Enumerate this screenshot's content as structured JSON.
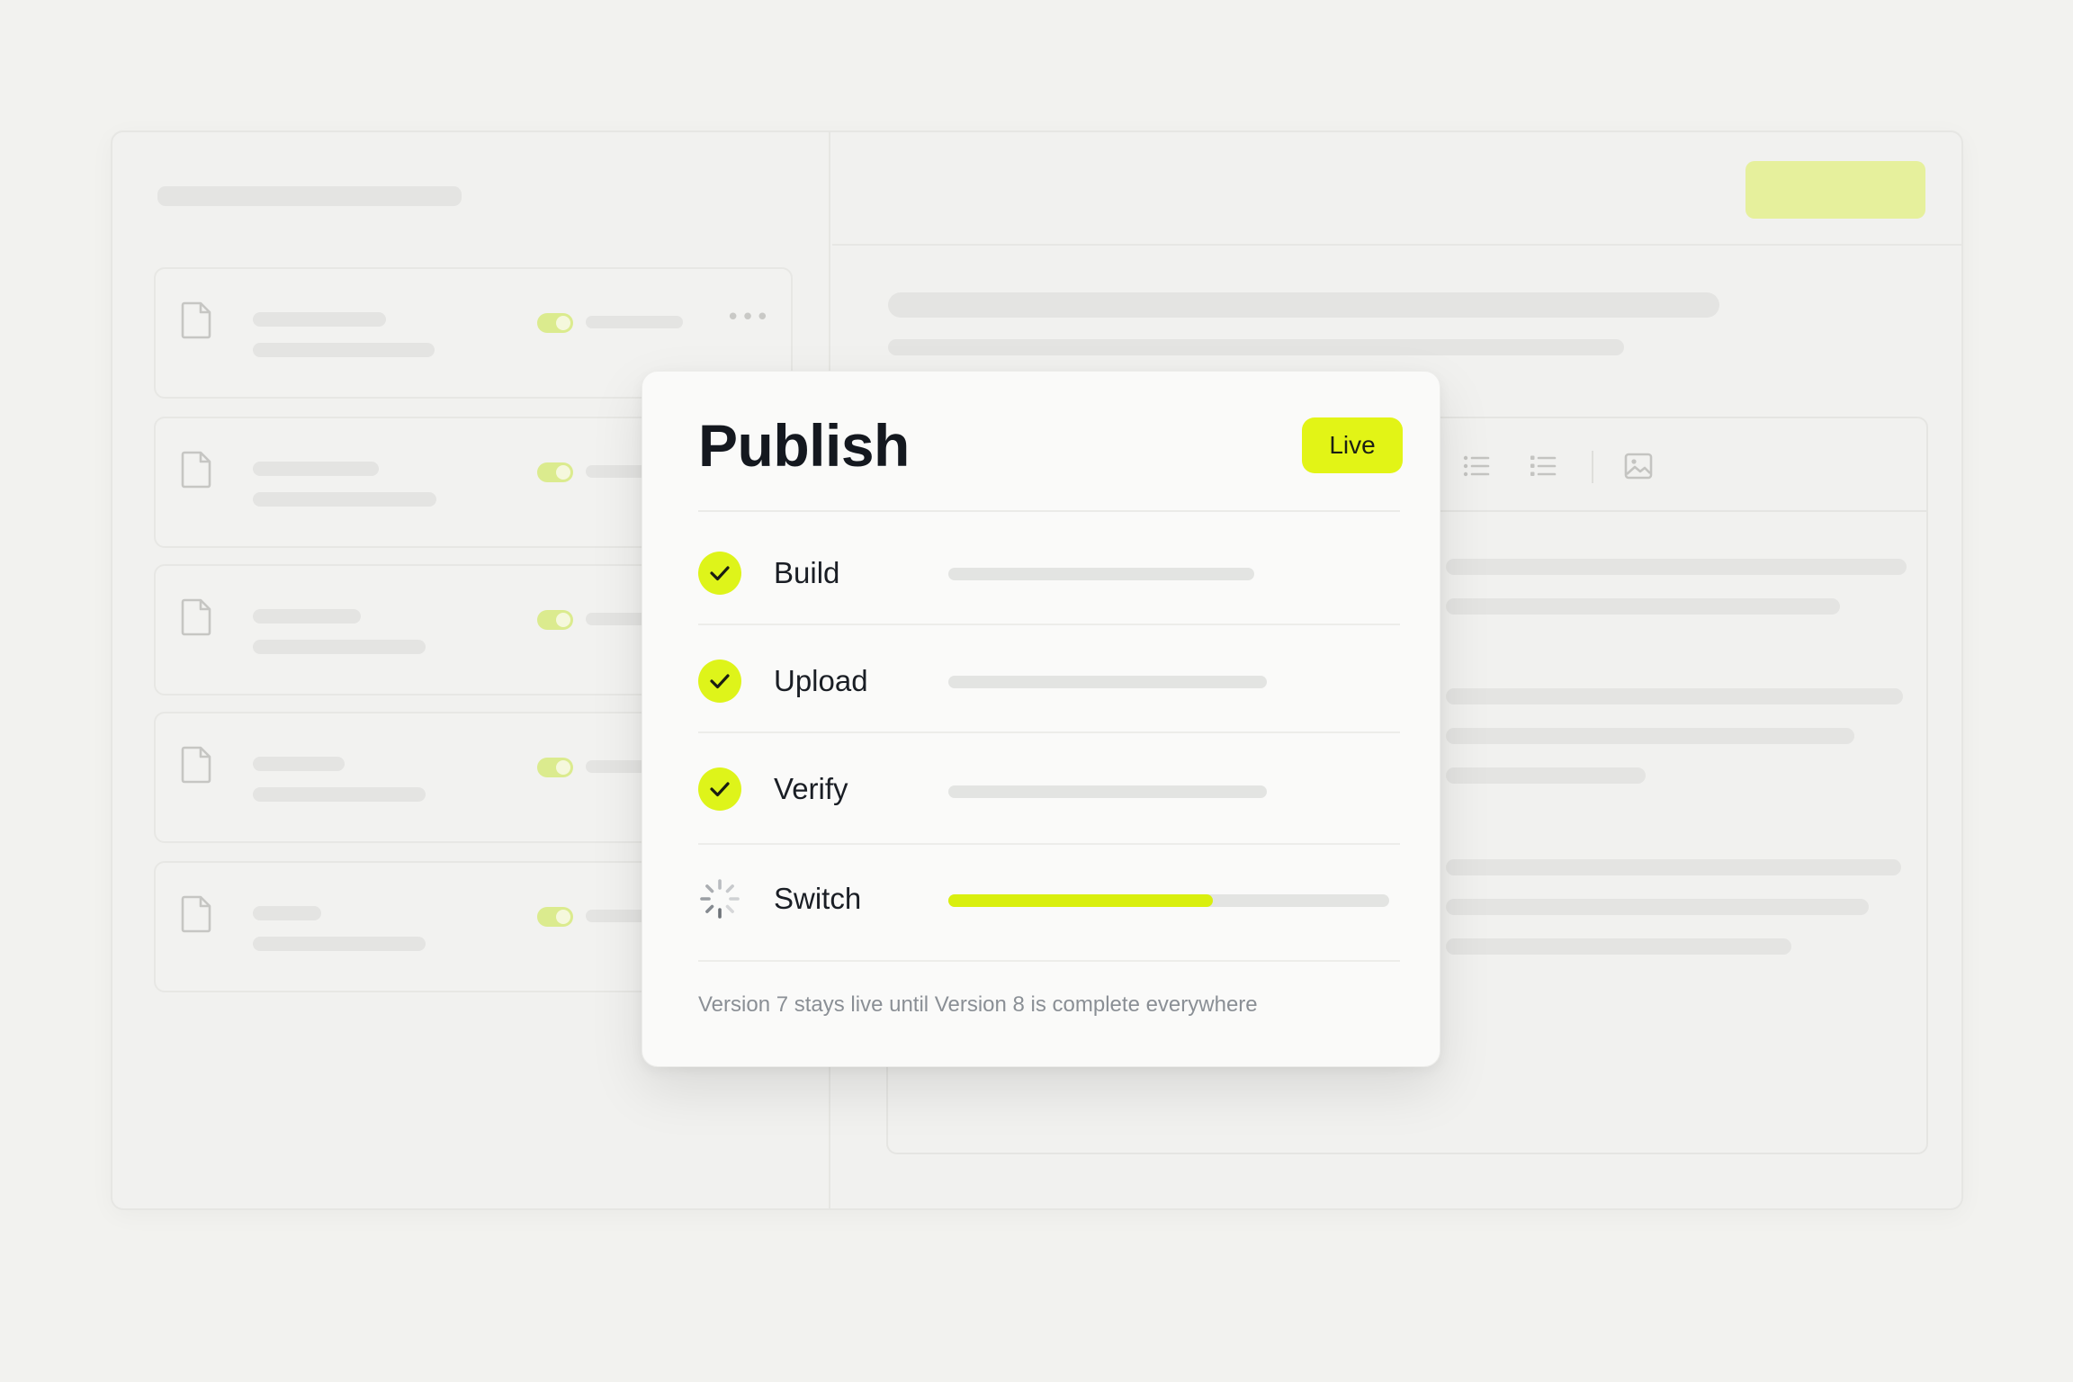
{
  "colors": {
    "accent": "#e2f416",
    "accent_muted": "#e6f09c",
    "text_primary": "#14181f",
    "text_muted": "#8a8f95",
    "track": "#e3e4e2"
  },
  "background_app": {
    "sidebar": {
      "file_cards": [
        {
          "icon": "document-icon",
          "toggle_on": true
        },
        {
          "icon": "document-icon",
          "toggle_on": true
        },
        {
          "icon": "document-icon",
          "toggle_on": true
        },
        {
          "icon": "document-icon",
          "toggle_on": true
        },
        {
          "icon": "document-icon",
          "toggle_on": true
        }
      ],
      "more_icon": "more-horizontal-icon"
    },
    "editor_toolbar_icons": [
      "bulleted-list-icon",
      "numbered-list-icon",
      "image-icon"
    ]
  },
  "dialog": {
    "title": "Publish",
    "badge": "Live",
    "steps": [
      {
        "label": "Build",
        "status": "complete",
        "icon": "check-icon"
      },
      {
        "label": "Upload",
        "status": "complete",
        "icon": "check-icon"
      },
      {
        "label": "Verify",
        "status": "complete",
        "icon": "check-icon"
      },
      {
        "label": "Switch",
        "status": "in-progress",
        "icon": "spinner-icon",
        "progress": 0.6
      }
    ],
    "note": "Version 7 stays live until Version 8 is complete everywhere"
  }
}
